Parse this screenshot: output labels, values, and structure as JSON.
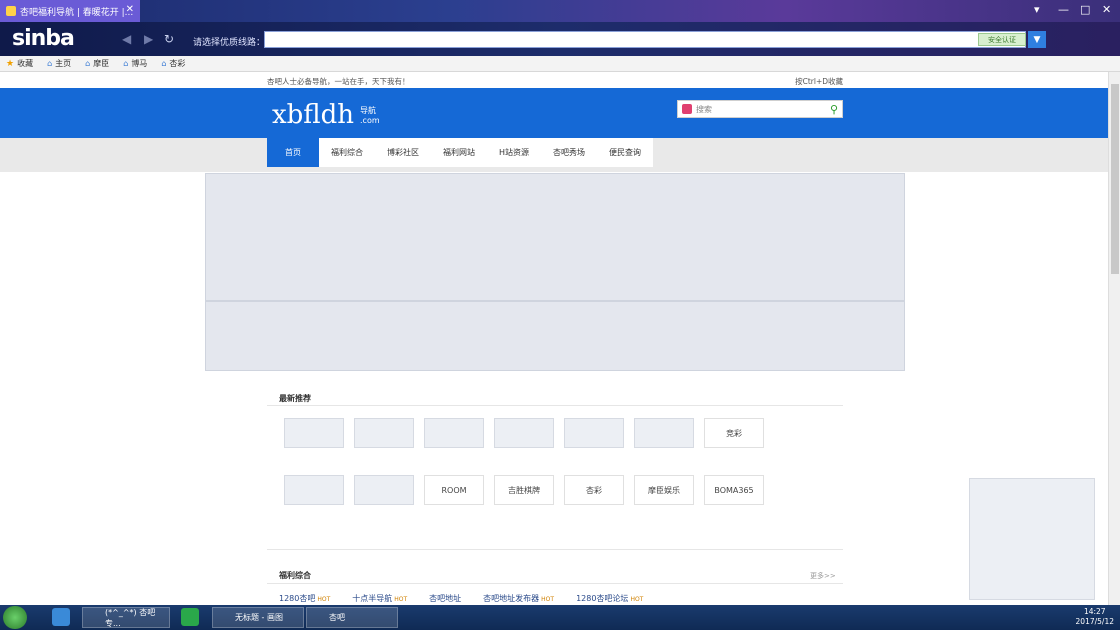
{
  "window": {
    "tab_title": "杏吧福利导航 | 春暖花开 |...",
    "controls": [
      "▾",
      "—",
      "□",
      "✕"
    ]
  },
  "toolbar": {
    "logo": "sinba",
    "address_label": "请选择优质线路：",
    "cert_label": "安全认证"
  },
  "favorites": {
    "items": [
      {
        "label": "收藏",
        "icon": "star-icon"
      },
      {
        "label": "主页",
        "icon": "house-icon"
      },
      {
        "label": "摩臣",
        "icon": "house-icon"
      },
      {
        "label": "博马",
        "icon": "house-icon"
      },
      {
        "label": "杏彩",
        "icon": "house-icon"
      }
    ]
  },
  "page": {
    "slogan": "杏吧人士必备导航，一站在手，天下我有！",
    "bookmark_hint": "按Ctrl+D收藏",
    "logo_main": "xbfldh",
    "logo_sub": "导航",
    "logo_com": ".com",
    "search_placeholder": "搜索",
    "menu": [
      "首页",
      "福利综合",
      "博彩社区",
      "福利网站",
      "H站资源",
      "杏吧秀场",
      "便民查询"
    ],
    "section_latest": "最新推荐",
    "brand_tiles": {
      "row1_last": "竞彩",
      "room": "ROOM",
      "chess": "吉胜棋牌",
      "xingcai": "杏彩",
      "mc": "摩臣娱乐",
      "boma": "BOMA365"
    },
    "section_welfare": "福利综合",
    "more": "更多>>",
    "links": [
      {
        "label": "1280杏吧",
        "hot": "HOT"
      },
      {
        "label": "十点半导航",
        "hot": "HOT"
      },
      {
        "label": "杏吧地址",
        "hot": ""
      },
      {
        "label": "杏吧地址发布器",
        "hot": "HOT"
      },
      {
        "label": "1280杏吧论坛",
        "hot": "HOT"
      }
    ]
  },
  "taskbar": {
    "apps": [
      "(*^_^*) 杏吧专...",
      "无标题 - 画图",
      "杏吧"
    ],
    "time": "14:27",
    "date": "2017/5/12"
  }
}
